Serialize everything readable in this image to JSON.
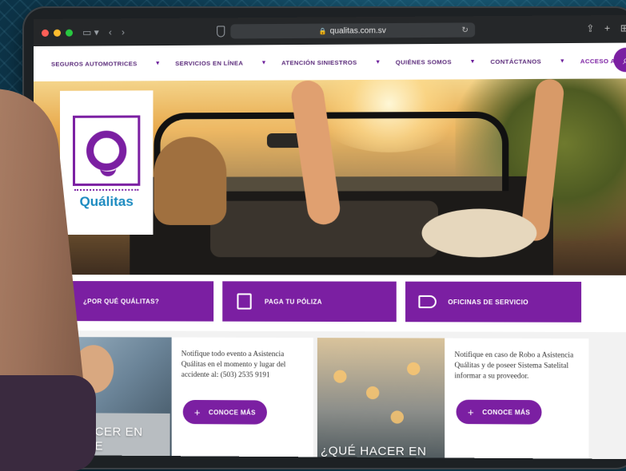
{
  "browser": {
    "url": "qualitas.com.sv"
  },
  "nav": {
    "items": [
      {
        "label": "SEGUROS AUTOMOTRICES"
      },
      {
        "label": "SERVICIOS EN LÍNEA"
      },
      {
        "label": "ATENCIÓN SINIESTROS"
      },
      {
        "label": "QUIÉNES SOMOS"
      },
      {
        "label": "CONTÁCTANOS"
      },
      {
        "label": "ACCESO AGENTES"
      }
    ]
  },
  "hero": {
    "logo_text": "Quálitas",
    "slides": 4,
    "active_slide": 3
  },
  "actions": [
    {
      "label": "¿POR QUÉ QUÁLITAS?",
      "icon": "megaphone-icon"
    },
    {
      "label": "PAGA TU PÓLIZA",
      "icon": "calculator-icon"
    },
    {
      "label": "OFICINAS DE SERVICIO",
      "icon": "megaphone-icon"
    }
  ],
  "cards": [
    {
      "overlay_title": "QUÉ HACER EN CASO DE",
      "text": "Notifique todo evento a Asistencia Quálitas en el momento y lugar del accidente al: (503) 2535 9191",
      "button": "CONOCE MÁS"
    },
    {
      "overlay_title": "¿QUÉ HACER EN",
      "text": "Notifique en caso de Robo a Asistencia Quálitas y de poseer Sistema Satelital informar a su proveedor.",
      "button": "CONOCE MÁS"
    }
  ],
  "colors": {
    "brand_purple": "#7b1fa2",
    "brand_blue": "#1b8ac0"
  }
}
